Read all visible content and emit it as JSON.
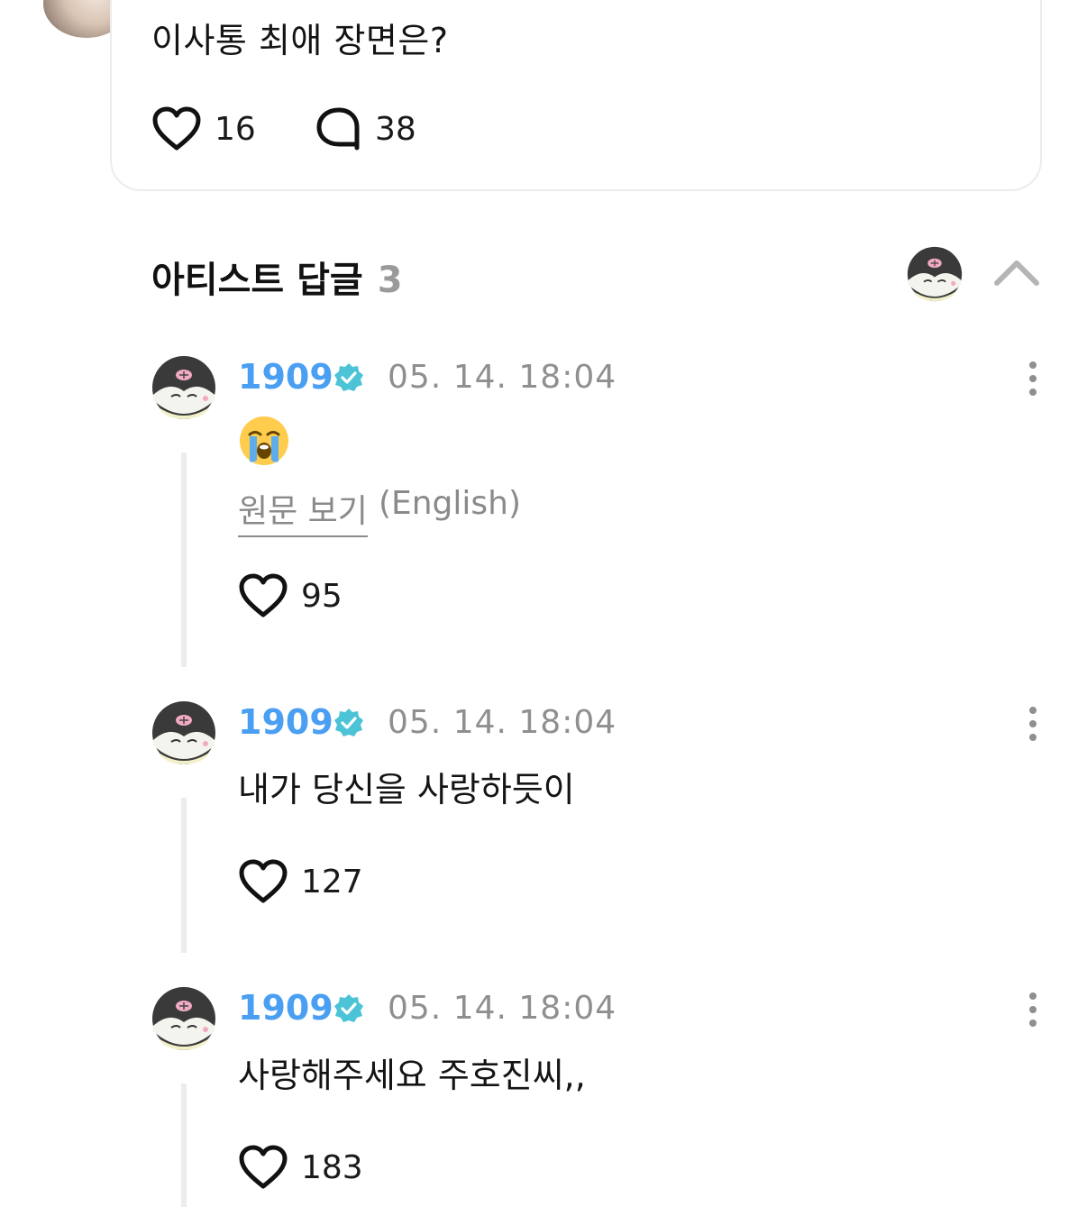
{
  "post": {
    "text": "이사통 최애 장면은?",
    "likes": "16",
    "comments": "38"
  },
  "artist_replies": {
    "title": "아티스트 답글",
    "count": "3"
  },
  "replies": [
    {
      "name": "1909",
      "time": "05. 14. 18:04",
      "body": "",
      "emoji": "loudly-crying-face",
      "translate_link": "원문 보기",
      "translate_lang": "(English)",
      "likes": "95"
    },
    {
      "name": "1909",
      "time": "05. 14. 18:04",
      "body": "내가 당신을 사랑하듯이",
      "likes": "127"
    },
    {
      "name": "1909",
      "time": "05. 14. 18:04",
      "body": "사랑해주세요 주호진씨,,",
      "likes": "183"
    }
  ],
  "colors": {
    "username": "#4a9ff2",
    "verified": "#4cc3d6",
    "muted": "#8f8f8f",
    "thread_line": "#ececec"
  },
  "icons": {
    "like": "heart-icon",
    "comment": "speech-bubble-icon",
    "verified": "verified-badge-icon",
    "more": "more-vertical-icon",
    "collapse": "chevron-up-icon"
  }
}
